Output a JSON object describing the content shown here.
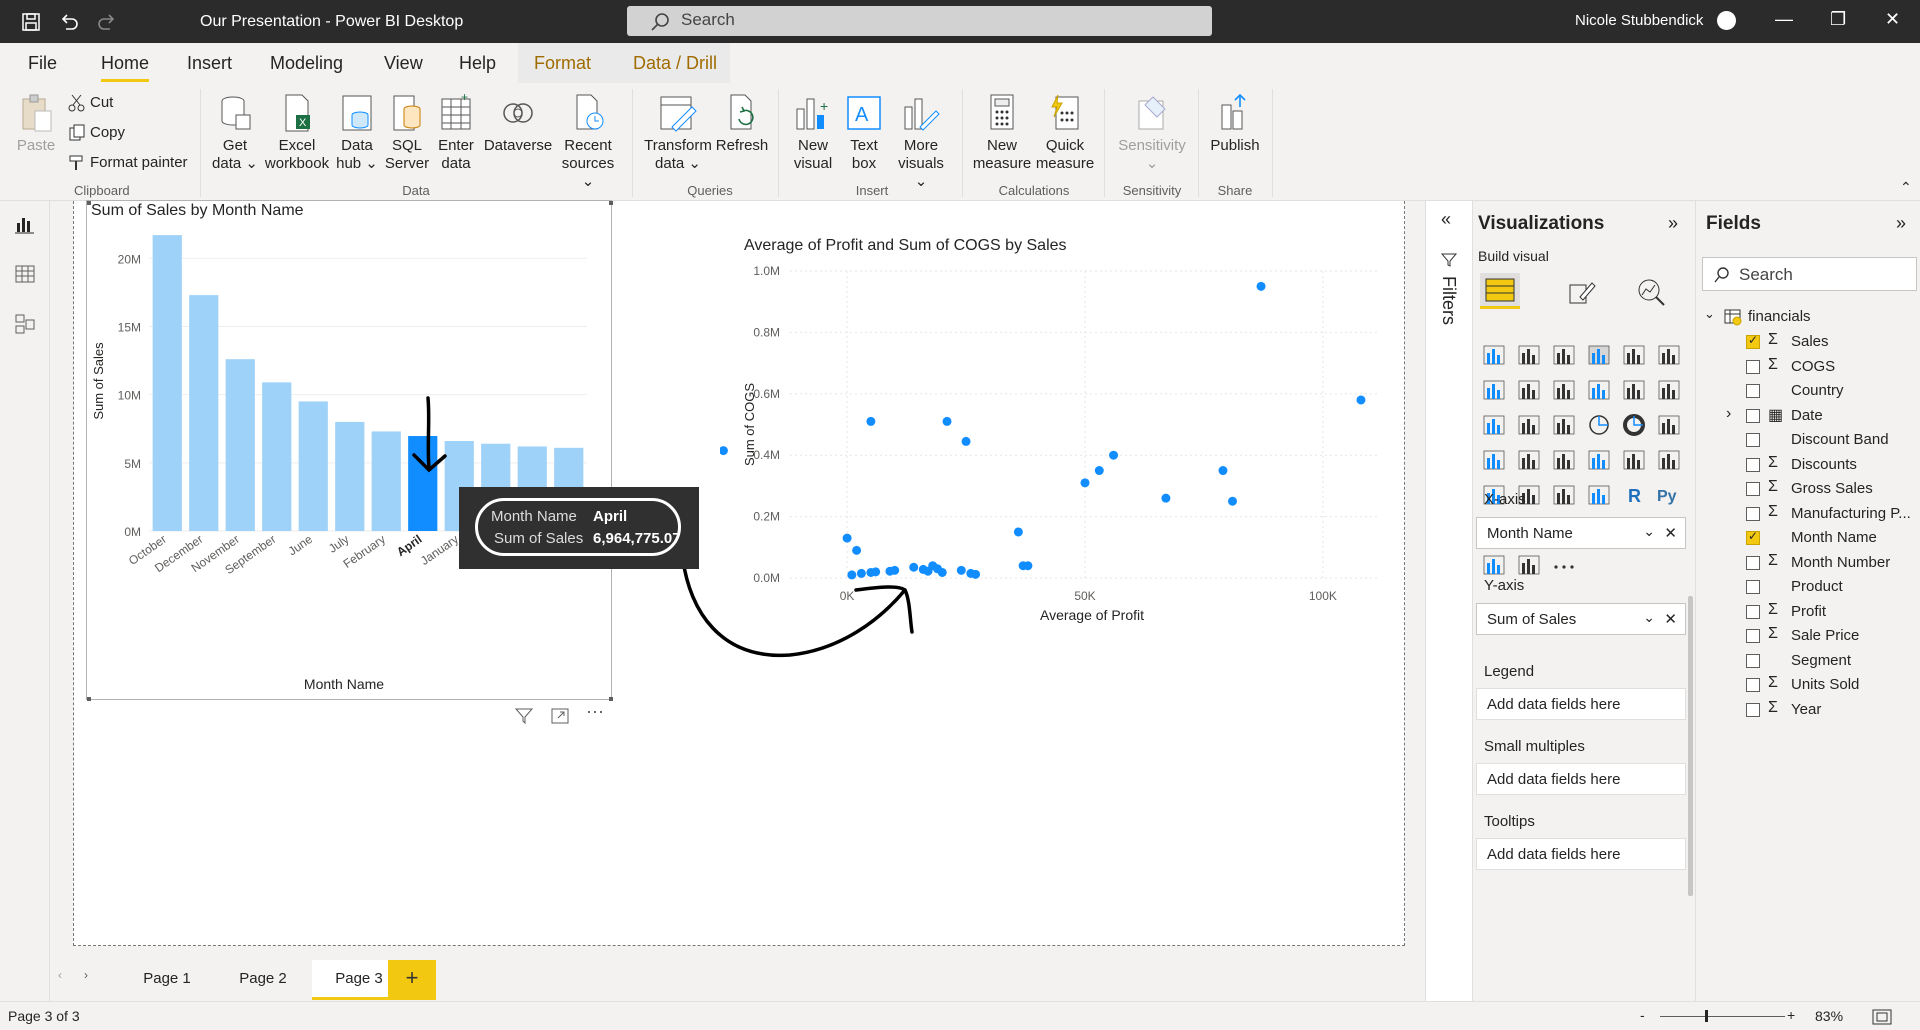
{
  "titlebar": {
    "title": "Our Presentation - Power BI Desktop",
    "search_placeholder": "Search",
    "user": "Nicole Stubbendick"
  },
  "menu": {
    "tabs": [
      "File",
      "Home",
      "Insert",
      "Modeling",
      "View",
      "Help",
      "Format",
      "Data / Drill"
    ],
    "active": "Home"
  },
  "ribbon": {
    "clipboard": {
      "paste": "Paste",
      "cut": "Cut",
      "copy": "Copy",
      "format_painter": "Format painter",
      "group": "Clipboard"
    },
    "data": {
      "get_data": [
        "Get",
        "data"
      ],
      "excel": [
        "Excel",
        "workbook"
      ],
      "data_hub": [
        "Data",
        "hub"
      ],
      "sql": [
        "SQL",
        "Server"
      ],
      "enter": [
        "Enter",
        "data"
      ],
      "dataverse": "Dataverse",
      "recent": [
        "Recent",
        "sources"
      ],
      "group": "Data"
    },
    "queries": {
      "transform": [
        "Transform",
        "data"
      ],
      "refresh": "Refresh",
      "group": "Queries"
    },
    "insert": {
      "new_visual": [
        "New",
        "visual"
      ],
      "text_box": [
        "Text",
        "box"
      ],
      "more_visuals": [
        "More",
        "visuals"
      ],
      "group": "Insert"
    },
    "calculations": {
      "new_measure": [
        "New",
        "measure"
      ],
      "quick_measure": [
        "Quick",
        "measure"
      ],
      "group": "Calculations"
    },
    "sensitivity": {
      "label": "Sensitivity",
      "group": "Sensitivity"
    },
    "share": {
      "publish": "Publish",
      "group": "Share"
    }
  },
  "chart1": {
    "tooltip": {
      "k1": "Month Name",
      "v1": "April",
      "k2": "Sum of Sales",
      "v2": "6,964,775.07"
    }
  },
  "chart_data": [
    {
      "type": "bar",
      "title": "Sum of Sales by Month Name",
      "xlabel": "Month Name",
      "ylabel": "Sum of Sales",
      "ylim": [
        0,
        22000000
      ],
      "yticks": [
        "0M",
        "5M",
        "10M",
        "15M",
        "20M"
      ],
      "categories": [
        "October",
        "December",
        "November",
        "September",
        "June",
        "July",
        "February",
        "April",
        "January",
        "May",
        "August",
        "March"
      ],
      "values": [
        21700000,
        17300000,
        12600000,
        10900000,
        9500000,
        8000000,
        7300000,
        6964775.07,
        6600000,
        6400000,
        6200000,
        6100000
      ],
      "highlight": "April",
      "colors": {
        "bar": "#9fd2f9",
        "highlight": "#118dff"
      }
    },
    {
      "type": "scatter",
      "title": "Average of Profit and Sum of COGS by Sales",
      "xlabel": "Average of Profit",
      "ylabel": "Sum of COGS",
      "xlim": [
        -12000,
        112000
      ],
      "ylim": [
        0,
        1000000
      ],
      "xticks": [
        "0K",
        "50K",
        "100K"
      ],
      "yticks": [
        "0.0M",
        "0.2M",
        "0.4M",
        "0.6M",
        "0.8M",
        "1.0M"
      ],
      "color": "#118dff",
      "points": [
        [
          -26000,
          415000
        ],
        [
          5000,
          510000
        ],
        [
          21000,
          510000
        ],
        [
          25000,
          445000
        ],
        [
          0,
          130000
        ],
        [
          2000,
          90000
        ],
        [
          1000,
          10000
        ],
        [
          3000,
          15000
        ],
        [
          5000,
          18000
        ],
        [
          6000,
          20000
        ],
        [
          9000,
          22000
        ],
        [
          10000,
          25000
        ],
        [
          14000,
          35000
        ],
        [
          16000,
          28000
        ],
        [
          17000,
          22000
        ],
        [
          18000,
          40000
        ],
        [
          19000,
          30000
        ],
        [
          20000,
          18000
        ],
        [
          24000,
          25000
        ],
        [
          26000,
          15000
        ],
        [
          27000,
          12000
        ],
        [
          36000,
          150000
        ],
        [
          37000,
          40000
        ],
        [
          38000,
          40000
        ],
        [
          50000,
          310000
        ],
        [
          53000,
          350000
        ],
        [
          56000,
          400000
        ],
        [
          67000,
          260000
        ],
        [
          79000,
          350000
        ],
        [
          81000,
          250000
        ],
        [
          87000,
          950000
        ],
        [
          108000,
          580000
        ]
      ]
    }
  ],
  "viz": {
    "title": "Visualizations",
    "build": "Build visual",
    "xaxis_label": "X-axis",
    "xaxis_value": "Month Name",
    "yaxis_label": "Y-axis",
    "yaxis_value": "Sum of Sales",
    "legend_label": "Legend",
    "legend_placeholder": "Add data fields here",
    "small_label": "Small multiples",
    "small_placeholder": "Add data fields here",
    "tooltips_label": "Tooltips",
    "tooltips_placeholder": "Add data fields here"
  },
  "filters": {
    "label": "Filters"
  },
  "fields": {
    "title": "Fields",
    "search": "Search",
    "table": "financials",
    "items": [
      {
        "name": "Sales",
        "sigma": true,
        "checked": true
      },
      {
        "name": "COGS",
        "sigma": true,
        "checked": false
      },
      {
        "name": "Country",
        "sigma": false,
        "checked": false
      },
      {
        "name": "Date",
        "sigma": false,
        "checked": false,
        "calendar": true
      },
      {
        "name": "Discount Band",
        "sigma": false,
        "checked": false
      },
      {
        "name": "Discounts",
        "sigma": true,
        "checked": false
      },
      {
        "name": "Gross Sales",
        "sigma": true,
        "checked": false
      },
      {
        "name": "Manufacturing P...",
        "sigma": true,
        "checked": false
      },
      {
        "name": "Month Name",
        "sigma": false,
        "checked": true
      },
      {
        "name": "Month Number",
        "sigma": true,
        "checked": false
      },
      {
        "name": "Product",
        "sigma": false,
        "checked": false
      },
      {
        "name": "Profit",
        "sigma": true,
        "checked": false
      },
      {
        "name": "Sale Price",
        "sigma": true,
        "checked": false
      },
      {
        "name": "Segment",
        "sigma": false,
        "checked": false
      },
      {
        "name": "Units Sold",
        "sigma": true,
        "checked": false
      },
      {
        "name": "Year",
        "sigma": true,
        "checked": false
      }
    ]
  },
  "pages": {
    "tabs": [
      "Page 1",
      "Page 2",
      "Page 3"
    ],
    "active": "Page 3",
    "add": "+"
  },
  "status": {
    "page": "Page 3 of 3",
    "zoom": "83%"
  }
}
